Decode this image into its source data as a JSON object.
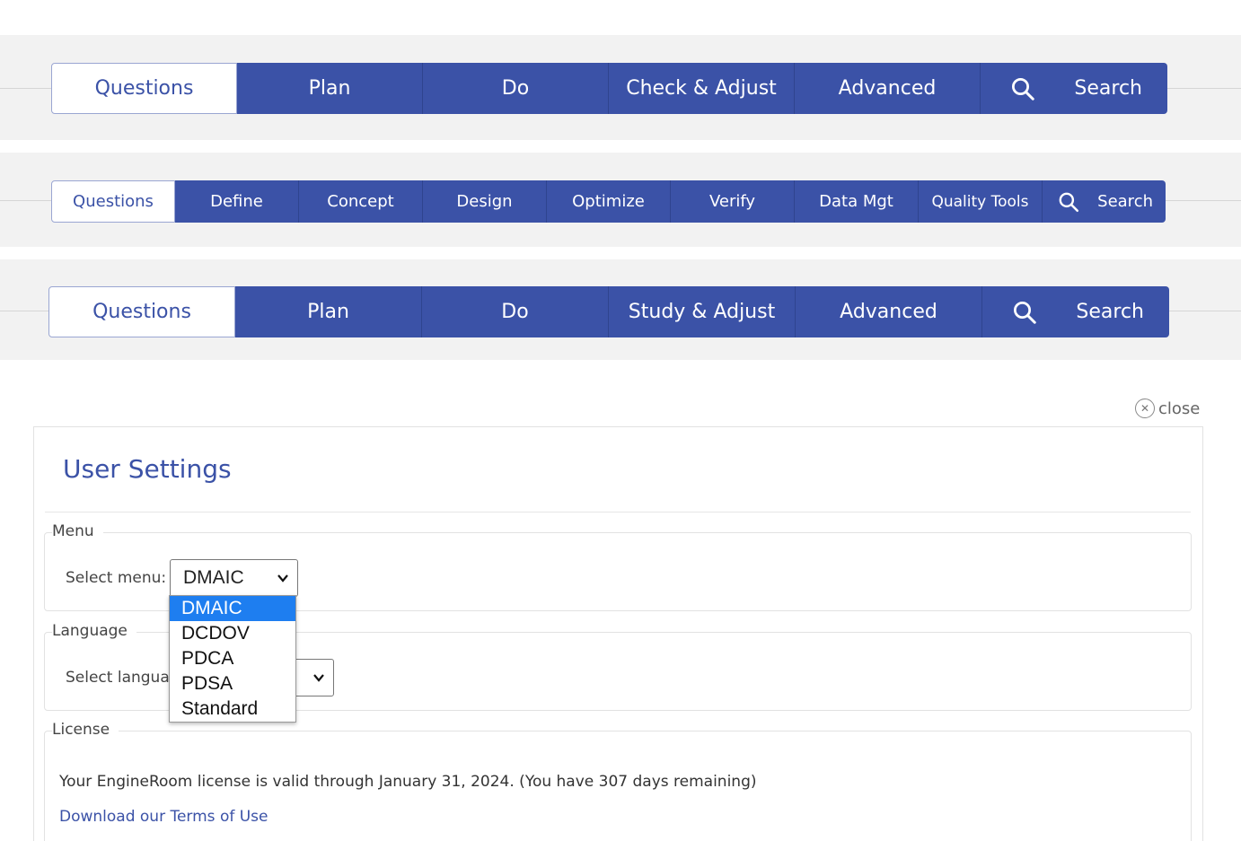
{
  "menubar_dmaic_like": {
    "items": [
      "Questions",
      "Plan",
      "Do",
      "Check & Adjust",
      "Advanced"
    ],
    "search_label": "Search"
  },
  "menubar_dcdov": {
    "items": [
      "Questions",
      "Define",
      "Concept",
      "Design",
      "Optimize",
      "Verify",
      "Data Mgt",
      "Quality Tools"
    ],
    "search_label": "Search"
  },
  "menubar_pdsa": {
    "items": [
      "Questions",
      "Plan",
      "Do",
      "Study & Adjust",
      "Advanced"
    ],
    "search_label": "Search"
  },
  "close_label": "close",
  "settings": {
    "title": "User Settings",
    "menu": {
      "legend": "Menu",
      "label": "Select menu:",
      "selected": "DMAIC",
      "options": [
        "DMAIC",
        "DCDOV",
        "PDCA",
        "PDSA",
        "Standard"
      ]
    },
    "language": {
      "legend": "Language",
      "label": "Select language:"
    },
    "license": {
      "legend": "License",
      "text": "Your EngineRoom license is valid through January 31, 2024. (You have 307 days remaining)",
      "link": "Download our Terms of Use"
    }
  },
  "colors": {
    "brand_blue": "#3b52a7",
    "selected_option": "#1e7ef0"
  }
}
